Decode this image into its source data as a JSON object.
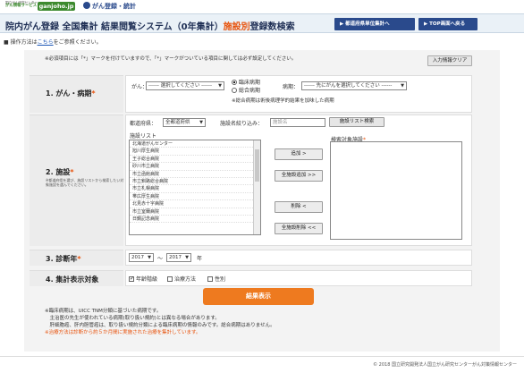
{
  "logo": {
    "small_line1": "国立がん研究センター",
    "small_line2": "がん情報サービス",
    "ganjoho": "ganjoho.jp",
    "torokustat": "がん登録・統計"
  },
  "title": {
    "main": "院内がん登録 全国集計 結果閲覧システム（0年集計）",
    "accent": "施設別",
    "suffix": "登録数検索"
  },
  "nav": {
    "prefecture_btn": "▶ 都道府県単位集計へ",
    "top_btn": "▶ TOP画面へ戻る"
  },
  "howto": {
    "prefix": "■ 操作方法は",
    "link": "こちら",
    "suffix": "をご参照ください。"
  },
  "required_note": "※必須項目には「*」マークを付けていますので、「*」マークがついている項目に関しては必ず設定してください。",
  "clear_button": "入力情報クリア",
  "section1": {
    "label": "1. がん・病期",
    "cancer_label": "がん：",
    "cancer_select": "------ 選択してください ------",
    "radio_clinical": "臨床病期",
    "radio_combined": "総合病期",
    "stage_label": "病期：",
    "stage_select": "------ 先にがんを選択してください ------",
    "note": "※総合病期は術後病理学的結果を加味した病期"
  },
  "section2": {
    "label": "2. 施設",
    "sub": "※都道府県を選び、施設リストから検索したい対象施設を選んでください。",
    "pref_label": "都道府県：",
    "pref_select": "全都道府県",
    "name_label": "施設名絞り込み：",
    "name_placeholder": "施設名",
    "search_btn": "施設リスト検索",
    "list_label": "施設リスト",
    "target_label": "検索対象施設",
    "facilities": [
      "北海道がんセンター",
      "旭川厚生病院",
      "王子総合病院",
      "砂川市立病院",
      "市立函館病院",
      "市立釧路総合病院",
      "市立札幌病院",
      "帯広厚生病院",
      "北見赤十字病院",
      "市立室蘭病院",
      "日鋼記念病院"
    ],
    "btn_add": "追加 >",
    "btn_add_all": "全施設追加 >>",
    "btn_remove": "削除 <",
    "btn_remove_all": "全施設削除 <<"
  },
  "section3": {
    "label": "3. 診断年",
    "from": "2017",
    "tilde": "～",
    "to": "2017",
    "unit": "年"
  },
  "section4": {
    "label": "4. 集計表示対象",
    "check_age": "年齢階級",
    "check_treatment": "治療方法",
    "check_sex": "性別"
  },
  "result_button": "結果表示",
  "notes": {
    "line1": "※臨床病期は、UICC TNM分類に基づいた病期です。",
    "line2": "　主治医の先生が使われている病期(取り扱い規約)とは異なる場合があります。",
    "line3": "　肝細胞癌、肝内胆管癌は、取り扱い規約分類による臨床病期の情報のみです。総合病期はありません。",
    "line4": "※治療方法は診断から約５か月間に実施された治療を集計しています。"
  },
  "footer": "© 2018 国立研究開発法人国立がん研究センターがん対策情報センター",
  "colors": {
    "accent": "#e8530d",
    "nav": "#2a4a8c",
    "brand_green": "#3d8a2f",
    "button_orange": "#ee7a1f"
  }
}
